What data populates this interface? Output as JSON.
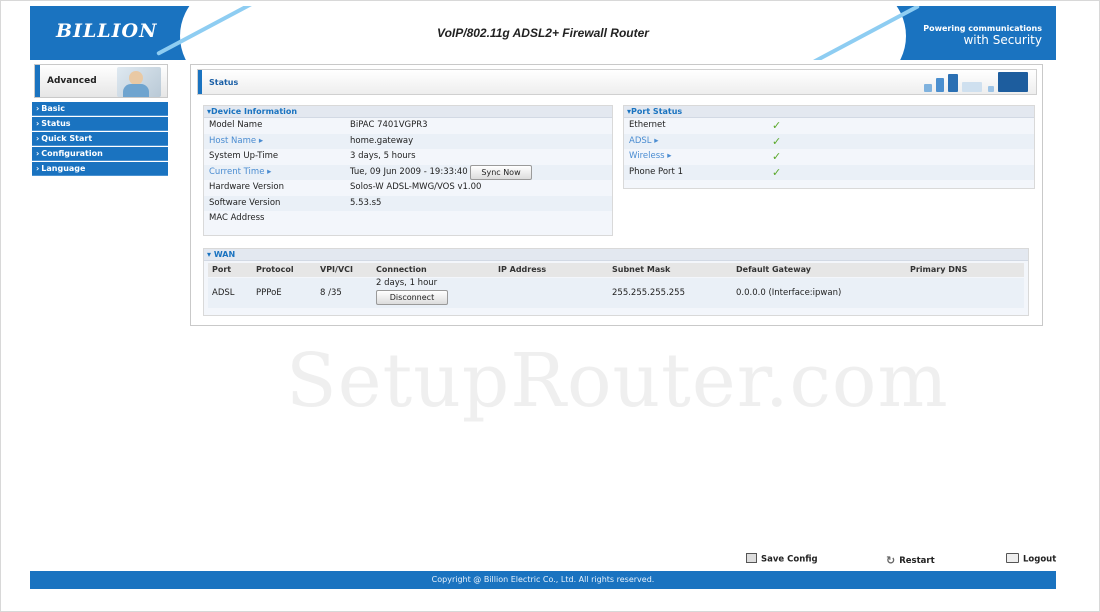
{
  "header": {
    "logo": "BILLION",
    "title": "VoIP/802.11g ADSL2+ Firewall Router",
    "tagline_small": "Powering communications",
    "tagline_big": "with Security"
  },
  "sidebar": {
    "mode": "Advanced",
    "items": [
      {
        "label": "Basic"
      },
      {
        "label": "Status"
      },
      {
        "label": "Quick Start"
      },
      {
        "label": "Configuration"
      },
      {
        "label": "Language"
      }
    ]
  },
  "page": {
    "title": "Status"
  },
  "device_info": {
    "heading": "Device Information",
    "rows": [
      {
        "label": "Model Name",
        "value": "BiPAC 7401VGPR3"
      },
      {
        "label": "Host Name",
        "value": "home.gateway"
      },
      {
        "label": "System Up-Time",
        "value": "3 days, 5 hours"
      },
      {
        "label": "Current Time",
        "value": "Tue, 09 Jun 2009 - 19:33:40"
      },
      {
        "label": "Hardware Version",
        "value": "Solos-W ADSL-MWG/VOS v1.00"
      },
      {
        "label": "Software Version",
        "value": "5.53.s5"
      },
      {
        "label": "MAC Address",
        "value": ""
      }
    ],
    "sync_button": "Sync Now"
  },
  "port_status": {
    "heading": "Port Status",
    "rows": [
      {
        "label": "Ethernet",
        "status": "ok"
      },
      {
        "label": "ADSL",
        "status": "ok"
      },
      {
        "label": "Wireless",
        "status": "ok"
      },
      {
        "label": "Phone Port 1",
        "status": "ok"
      }
    ],
    "check_glyph": "✓"
  },
  "wan": {
    "heading": "WAN",
    "columns": [
      "Port",
      "Protocol",
      "VPI/VCI",
      "Connection",
      "IP Address",
      "Subnet Mask",
      "Default Gateway",
      "Primary DNS"
    ],
    "row": {
      "port": "ADSL",
      "protocol": "PPPoE",
      "vpi_vci": "8 /35",
      "connection": "2 days, 1 hour",
      "ip_address": "",
      "subnet_mask": "255.255.255.255",
      "default_gateway": "0.0.0.0 (Interface:ipwan)",
      "primary_dns": ""
    },
    "disconnect_button": "Disconnect"
  },
  "watermark": "SetupRouter.com",
  "actions": {
    "save": "Save Config",
    "restart": "Restart",
    "logout": "Logout"
  },
  "footer": {
    "copyright": "Copyright @ Billion Electric Co., Ltd. All rights reserved."
  },
  "colors": {
    "brand_blue": "#1a73c0",
    "link_blue": "#4a8cd1",
    "check_green": "#5aa82a"
  }
}
